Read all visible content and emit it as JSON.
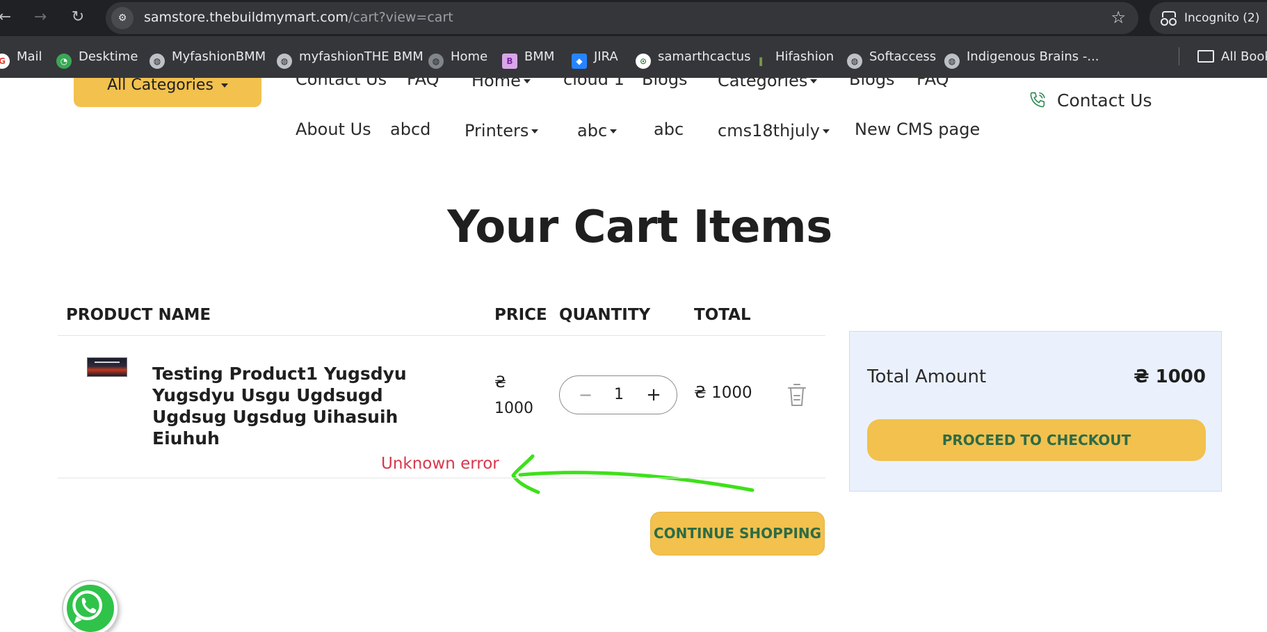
{
  "browser": {
    "url_host": "samstore.thebuildmymart.com",
    "url_path": "/cart?view=cart",
    "incognito_label": "Incognito (2)",
    "bookmarks": [
      {
        "label": "Mail",
        "icon": "google-icon"
      },
      {
        "label": "Desktime",
        "icon": "desktime-icon"
      },
      {
        "label": "MyfashionBMM",
        "icon": "globe-icon"
      },
      {
        "label": "myfashionTHE BMM",
        "icon": "globe-icon"
      },
      {
        "label": "Home",
        "icon": "globe-icon"
      },
      {
        "label": "BMM",
        "icon": "bmm-icon"
      },
      {
        "label": "JIRA",
        "icon": "jira-icon"
      },
      {
        "label": "samarthcactus",
        "icon": "cactus-icon"
      },
      {
        "label": "Hifashion",
        "icon": "hifashion-icon"
      },
      {
        "label": "Softaccess",
        "icon": "globe-icon"
      },
      {
        "label": "Indigenous Brains -...",
        "icon": "globe-icon"
      }
    ],
    "all_bookmarks_label": "All Bookmarks"
  },
  "site_nav": {
    "all_categories_label": "All Categories",
    "row1": [
      "Contact Us",
      "FAQ",
      "Home",
      "cloud 1",
      "Blogs",
      "Categories",
      "Blogs",
      "FAQ"
    ],
    "row2": [
      "About Us",
      "abcd",
      "Printers",
      "abc",
      "abc",
      "cms18thjuly",
      "New CMS page"
    ],
    "contact_us_label": "Contact Us"
  },
  "cart": {
    "title": "Your Cart Items",
    "columns": {
      "product": "PRODUCT NAME",
      "price": "PRICE",
      "quantity": "QUANTITY",
      "total": "TOTAL"
    },
    "item": {
      "name": "Testing Product1 Yugsdyu Yugsdyu Usgu Ugdsugd Ugdsug Ugsdug Uihasuih Eiuhuh",
      "price_symbol": "₴",
      "price_value": "1000",
      "quantity": "1",
      "minus": "−",
      "plus": "+",
      "total": "₴ 1000"
    },
    "error_message": "Unknown error",
    "continue_label": "CONTINUE SHOPPING"
  },
  "summary": {
    "total_label": "Total Amount",
    "total_value": "₴ 1000",
    "checkout_label": "PROCEED TO CHECKOUT"
  },
  "colors": {
    "accent_yellow": "#f2c14e",
    "button_text_green": "#2e6b45",
    "error_red": "#d9374b",
    "annotation_green": "#3ee01a",
    "summary_bg": "#eaf1fc"
  }
}
